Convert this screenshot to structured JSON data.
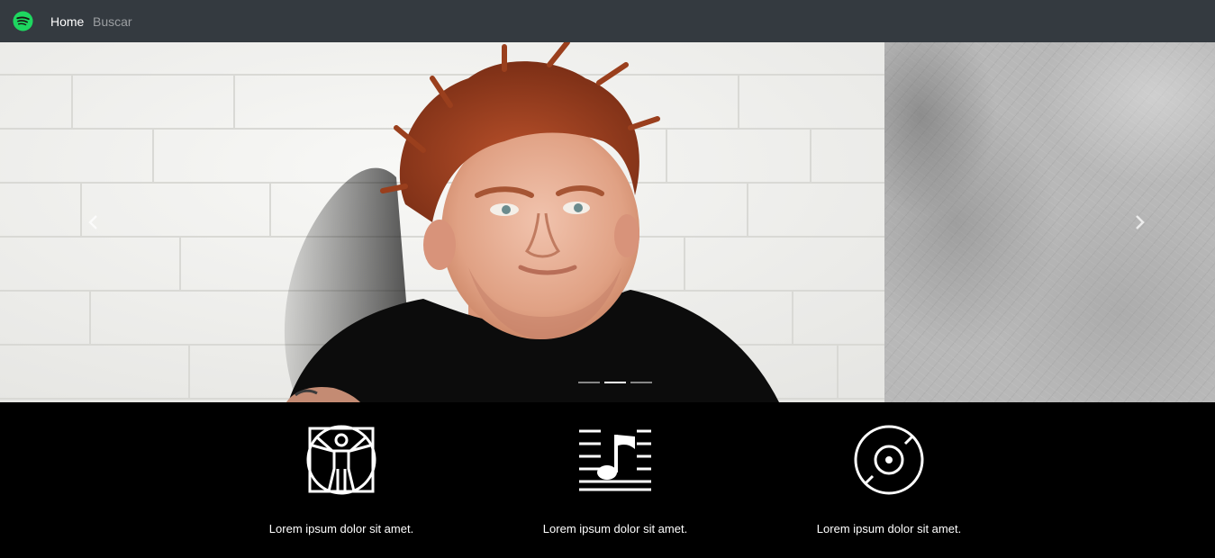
{
  "navbar": {
    "logo": "spotify-logo",
    "links": [
      {
        "label": "Home",
        "active": true
      },
      {
        "label": "Buscar",
        "active": false
      }
    ]
  },
  "carousel": {
    "slides": [
      {
        "image": "artist-photo"
      },
      {
        "image": "scratched-grey-texture"
      }
    ],
    "indicators": {
      "count": 3,
      "active_index": 1
    },
    "controls": {
      "prev_icon": "chevron-left-icon",
      "next_icon": "chevron-right-icon"
    }
  },
  "features": [
    {
      "icon": "vitruvian-man-icon",
      "text": "Lorem ipsum dolor sit amet."
    },
    {
      "icon": "music-staff-icon",
      "text": "Lorem ipsum dolor sit amet."
    },
    {
      "icon": "vinyl-disc-icon",
      "text": "Lorem ipsum dolor sit amet."
    }
  ],
  "colors": {
    "navbar_bg": "#343a40",
    "brand_green": "#1ed760",
    "features_bg": "#000000"
  }
}
